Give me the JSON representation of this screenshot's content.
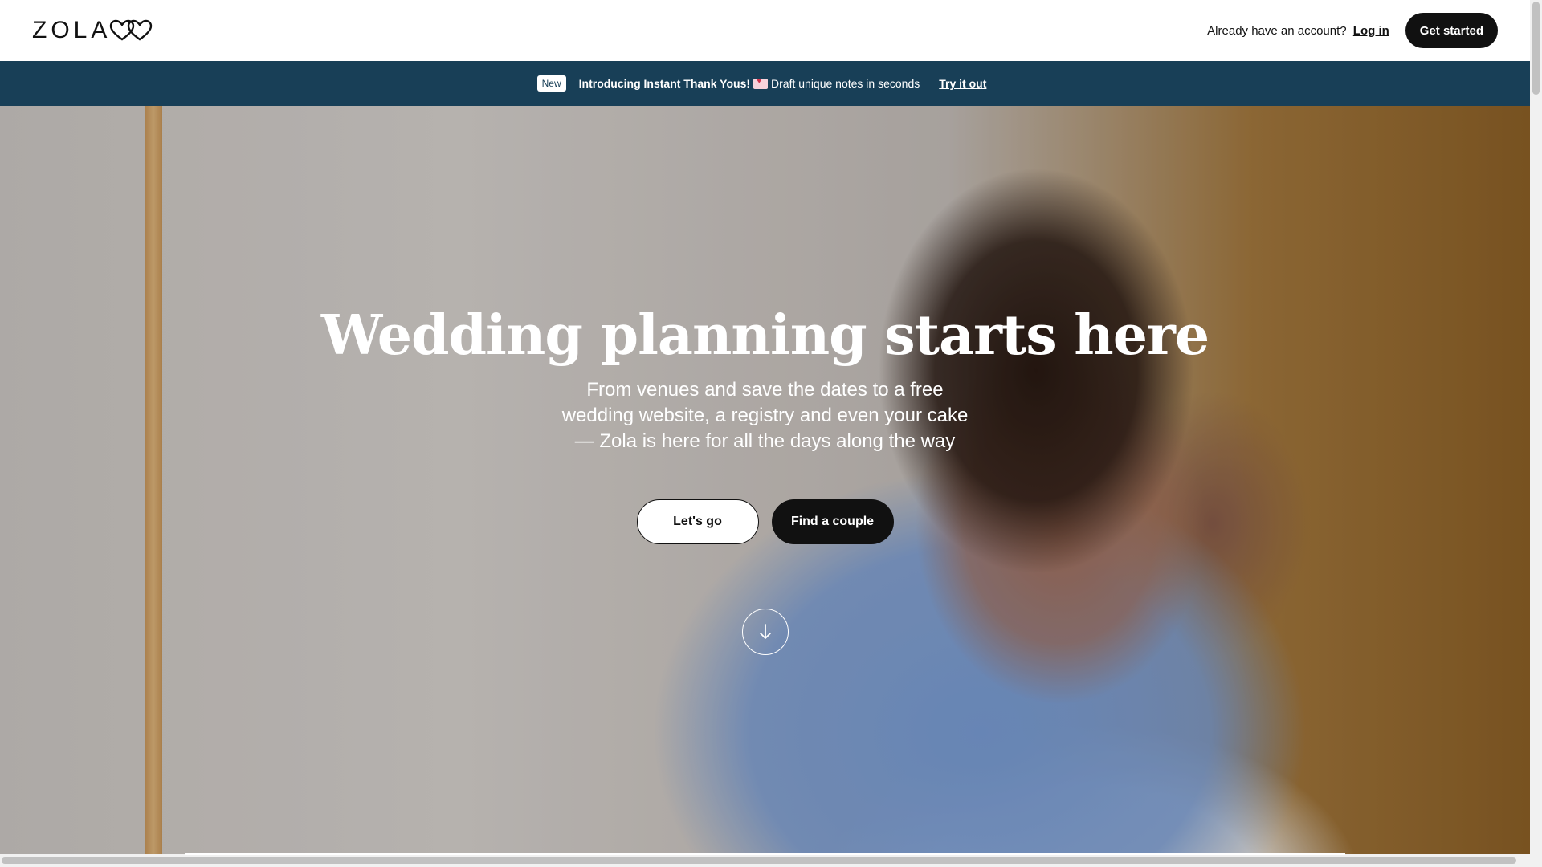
{
  "brand": {
    "logo_text": "ZOLA",
    "logo_icon": "hearts-logo-icon"
  },
  "header": {
    "account_prompt": "Already have an account?",
    "login_label": "Log in",
    "get_started_label": "Get started"
  },
  "announcement": {
    "badge": "New",
    "headline": "Introducing Instant Thank Yous!",
    "emoji_icon": "love-letter-icon",
    "body": "Draft unique notes in seconds",
    "link_label": "Try it out",
    "background_color": "#183f57"
  },
  "hero": {
    "title": "Wedding planning starts here",
    "subtitle": "From venues and save the dates to a free wedding website, a registry and even your cake — Zola is here for all the days along the way",
    "primary_button": "Let's go",
    "secondary_button": "Find a couple",
    "scroll_icon": "arrow-down-icon"
  }
}
